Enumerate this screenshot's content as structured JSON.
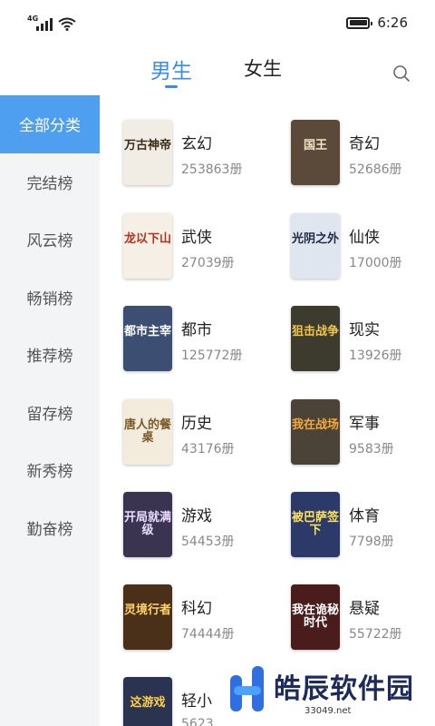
{
  "status_bar": {
    "network_label": "4G",
    "time": "6:26"
  },
  "tabs": [
    {
      "label": "男生",
      "active": true
    },
    {
      "label": "女生",
      "active": false
    }
  ],
  "search": {
    "icon": "search-icon"
  },
  "sidebar": {
    "items": [
      {
        "label": "全部分类",
        "active": true
      },
      {
        "label": "完结榜"
      },
      {
        "label": "风云榜"
      },
      {
        "label": "畅销榜"
      },
      {
        "label": "推荐榜"
      },
      {
        "label": "留存榜"
      },
      {
        "label": "新秀榜"
      },
      {
        "label": "勤奋榜"
      }
    ]
  },
  "categories": [
    {
      "name": "玄幻",
      "count": "253863册",
      "cover_text": "万古神帝",
      "cover_bg": "#f1ede4",
      "cover_fg": "#3b2a1a"
    },
    {
      "name": "奇幻",
      "count": "52686册",
      "cover_text": "国王",
      "cover_bg": "#5b4a3a",
      "cover_fg": "#f1e3c4"
    },
    {
      "name": "武侠",
      "count": "27039册",
      "cover_text": "龙以下山",
      "cover_bg": "#f5efe6",
      "cover_fg": "#b3321f"
    },
    {
      "name": "仙侠",
      "count": "17000册",
      "cover_text": "光阴之外",
      "cover_bg": "#dfe6ef",
      "cover_fg": "#1f2a45"
    },
    {
      "name": "都市",
      "count": "125772册",
      "cover_text": "都市主宰",
      "cover_bg": "#3c4f72",
      "cover_fg": "#ffffff"
    },
    {
      "name": "现实",
      "count": "13926册",
      "cover_text": "狙击战争",
      "cover_bg": "#3d3a2e",
      "cover_fg": "#f0c64a"
    },
    {
      "name": "历史",
      "count": "43176册",
      "cover_text": "唐人的餐桌",
      "cover_bg": "#f3ecdc",
      "cover_fg": "#7a5a2a"
    },
    {
      "name": "军事",
      "count": "9583册",
      "cover_text": "我在战场",
      "cover_bg": "#4b4338",
      "cover_fg": "#f4a73a"
    },
    {
      "name": "游戏",
      "count": "54453册",
      "cover_text": "开局就满级",
      "cover_bg": "#3a3450",
      "cover_fg": "#e8dcff"
    },
    {
      "name": "体育",
      "count": "7798册",
      "cover_text": "被巴萨签下",
      "cover_bg": "#2c3a6a",
      "cover_fg": "#ffe25a"
    },
    {
      "name": "科幻",
      "count": "74444册",
      "cover_text": "灵境行者",
      "cover_bg": "#4a3018",
      "cover_fg": "#ffd36a"
    },
    {
      "name": "悬疑",
      "count": "55722册",
      "cover_text": "我在诡秘时代",
      "cover_bg": "#4a1c1c",
      "cover_fg": "#ffffff"
    },
    {
      "name": "轻小",
      "count": "5623",
      "cover_text": "这游戏",
      "cover_bg": "#2a3450",
      "cover_fg": "#ffcf4a"
    }
  ],
  "watermark": {
    "title": "皓辰软件园",
    "url": "33049.net"
  }
}
